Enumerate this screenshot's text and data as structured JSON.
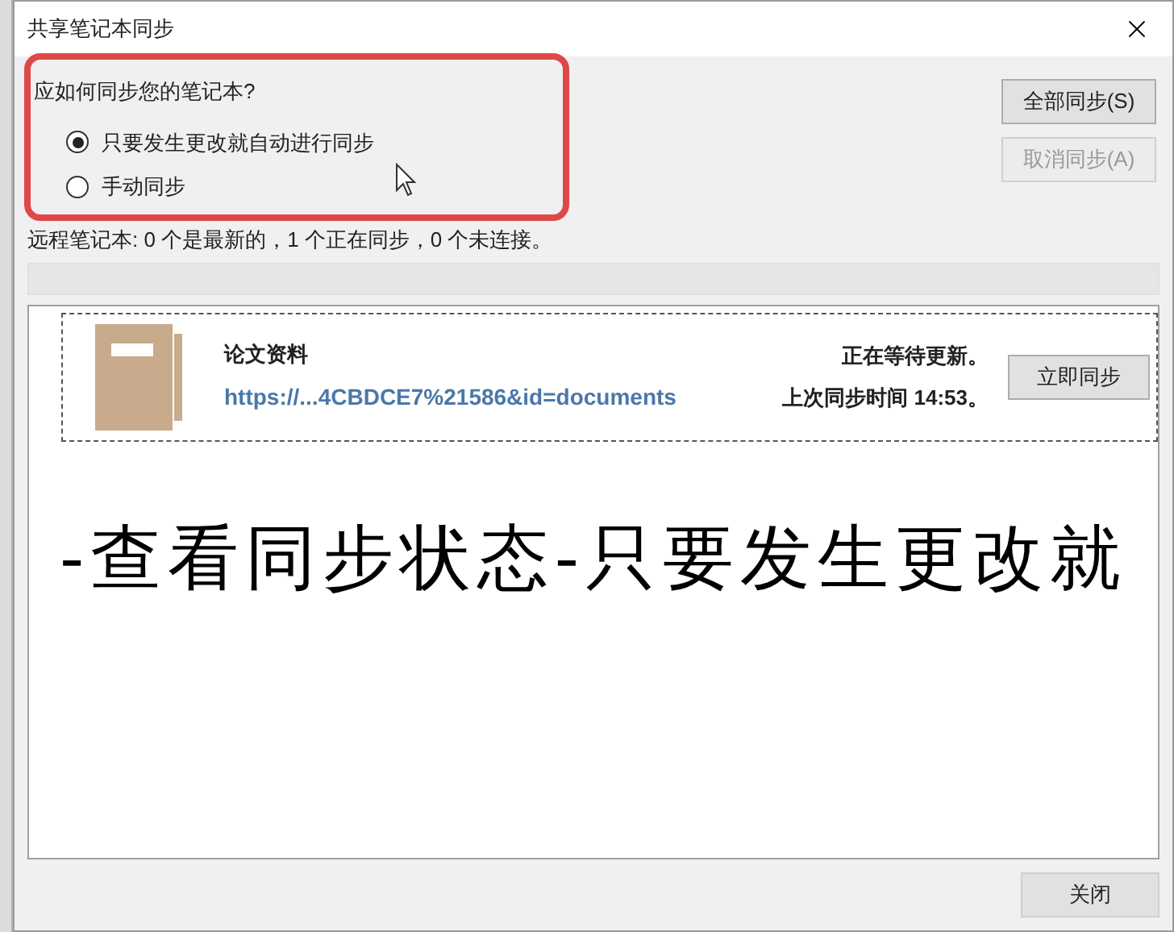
{
  "window": {
    "title": "共享笔记本同步"
  },
  "sync_mode": {
    "question": "应如何同步您的笔记本?",
    "options": [
      {
        "label": "只要发生更改就自动进行同步",
        "selected": true
      },
      {
        "label": "手动同步",
        "selected": false
      }
    ]
  },
  "side_buttons": [
    {
      "label": "全部同步(S)",
      "disabled": false
    },
    {
      "label": "取消同步(A)",
      "disabled": true
    }
  ],
  "status": "远程笔记本: 0 个是最新的，1 个正在同步，0 个未连接。",
  "notebooks": [
    {
      "name": "论文资料",
      "url": "https://...4CBDCE7%21586&id=documents",
      "state": "正在等待更新。",
      "last_sync": "上次同步时间 14:53。",
      "button": "立即同步"
    }
  ],
  "caption": "-查看同步状态-只要发生更改就",
  "close_button": "关闭"
}
